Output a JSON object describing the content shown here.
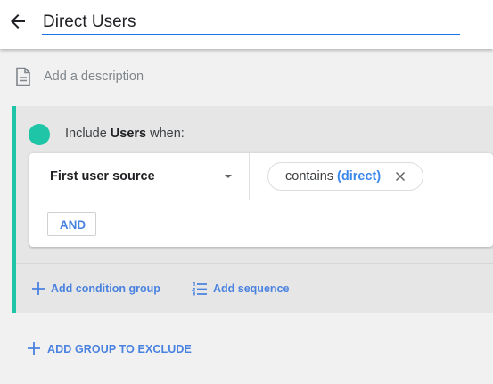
{
  "header": {
    "title": "Direct Users"
  },
  "description": {
    "placeholder": "Add a description"
  },
  "condition_group": {
    "include_prefix": "Include",
    "scope": "Users",
    "include_suffix": "when:",
    "condition": {
      "dimension": "First user source",
      "operator": "contains",
      "value": "(direct)"
    },
    "and_label": "AND",
    "add_condition_group_label": "Add condition group",
    "add_sequence_label": "Add sequence"
  },
  "exclude": {
    "label": "ADD GROUP TO EXCLUDE"
  },
  "colors": {
    "accent": "#1a73e8",
    "action_blue": "#4a82e0",
    "teal": "#1ec5a6"
  },
  "icons": {
    "back": "arrow-back-icon",
    "description": "document-icon",
    "dropdown": "caret-down-icon",
    "remove": "close-icon",
    "add": "plus-icon",
    "sequence": "list-numbered-icon"
  }
}
